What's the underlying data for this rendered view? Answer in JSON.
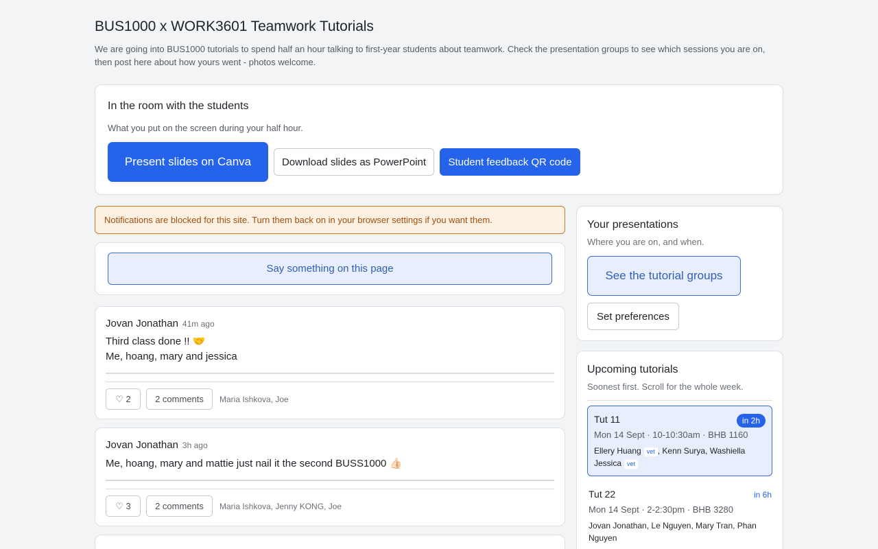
{
  "header": {
    "title": "BUS1000 x WORK3601 Teamwork Tutorials",
    "intro": "We are going into BUS1000 tutorials to spend half an hour talking to first-year students about teamwork. Check the presentation groups to see which sessions you are on, then post here about how yours went - photos welcome."
  },
  "room": {
    "title": "In the room with the students",
    "subtitle": "What you put on the screen during your half hour.",
    "present_label": "Present slides on Canva",
    "download_label": "Download slides as PowerPoint",
    "qr_label": "Student feedback QR code"
  },
  "notice": "Notifications are blocked for this site. Turn them back on in your browser settings if you want them.",
  "composer": {
    "label": "Say something on this page"
  },
  "posts": [
    {
      "author": "Jovan Jonathan",
      "time": "41m ago",
      "lines": [
        "Third class done !! 🤝",
        "Me, hoang, mary and jessica"
      ],
      "likes": "♡ 2",
      "comments": "2 comments",
      "likers": "Maria Ishkova, Joe"
    },
    {
      "author": "Jovan Jonathan",
      "time": "3h ago",
      "lines": [
        "Me, hoang, mary and mattie just nail it the second BUSS1000 👍🏻"
      ],
      "likes": "♡ 3",
      "comments": "2 comments",
      "likers": "Maria Ishkova, Jenny KONG, Joe"
    }
  ],
  "presentations": {
    "title": "Your presentations",
    "subtitle": "Where you are on, and when.",
    "groups_label": "See the tutorial groups",
    "prefs_label": "Set preferences"
  },
  "upcoming": {
    "title": "Upcoming tutorials",
    "subtitle": "Soonest first. Scroll for the whole week.",
    "vet_label": "vet",
    "items": [
      {
        "name": "Tut 11",
        "badge": "in 2h",
        "when": "Mon 14 Sept · 10-10:30am · BHB 1160",
        "p1": "Ellery Huang",
        "p2": ", Kenn Surya, Washiella",
        "p3": "Jessica"
      },
      {
        "name": "Tut 22",
        "badge": "in 6h",
        "when": "Mon 14 Sept · 2-2:30pm · BHB 3280",
        "people": "Jovan Jonathan, Le Nguyen, Mary Tran, Phan Nguyen"
      }
    ]
  },
  "colors": {
    "accent": "#2563eb",
    "notice_bg": "#fdf1e4",
    "notice_text": "#a34e0a"
  }
}
